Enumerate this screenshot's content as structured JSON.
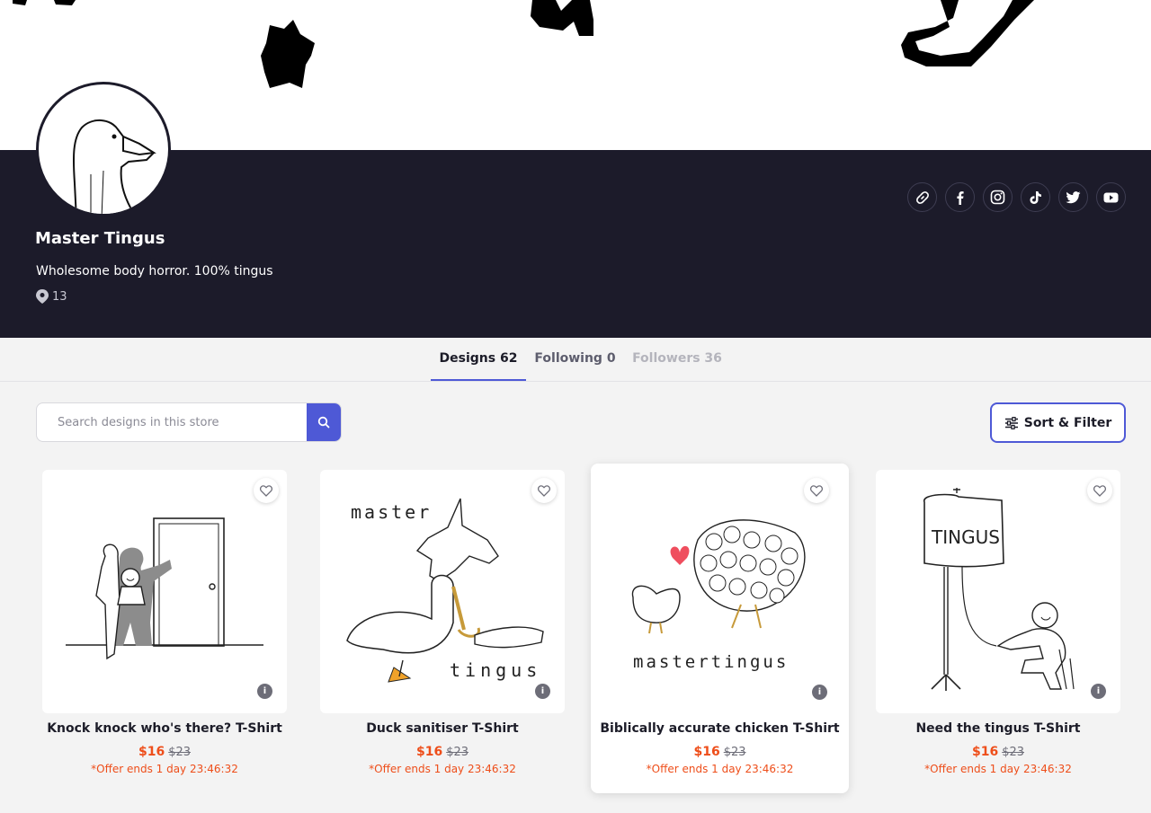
{
  "store": {
    "name": "Master Tingus",
    "description": "Wholesome body horror. 100% tingus",
    "location_count": "13"
  },
  "socials": [
    {
      "name": "link-icon"
    },
    {
      "name": "facebook-icon"
    },
    {
      "name": "instagram-icon"
    },
    {
      "name": "tiktok-icon"
    },
    {
      "name": "twitter-icon"
    },
    {
      "name": "youtube-icon"
    }
  ],
  "tabs": [
    {
      "label": "Designs 62",
      "active": true
    },
    {
      "label": "Following 0",
      "active": false
    },
    {
      "label": "Followers 36",
      "active": false
    }
  ],
  "search": {
    "placeholder": "Search designs in this store",
    "value": ""
  },
  "sort_filter": {
    "label": "Sort & Filter"
  },
  "colors": {
    "accent": "#4e59d6",
    "header_bg": "#1c1b2a",
    "sale": "#ee4e1a"
  },
  "products": [
    {
      "title": "Knock knock who's there? T-Shirt",
      "price": "$16",
      "original_price": "$23",
      "offer": "*Offer ends 1 day 23:46:32",
      "image_text": ""
    },
    {
      "title": "Duck sanitiser T-Shirt",
      "price": "$16",
      "original_price": "$23",
      "offer": "*Offer ends 1 day 23:46:32",
      "image_text_top": "master",
      "image_text_bottom": "tingus"
    },
    {
      "title": "Biblically accurate chicken T-Shirt",
      "price": "$16",
      "original_price": "$23",
      "offer": "*Offer ends 1 day 23:46:32",
      "image_text": "mastertingus"
    },
    {
      "title": "Need the tingus T-Shirt",
      "price": "$16",
      "original_price": "$23",
      "offer": "*Offer ends 1 day 23:46:32",
      "image_text": "TINGUS"
    }
  ]
}
